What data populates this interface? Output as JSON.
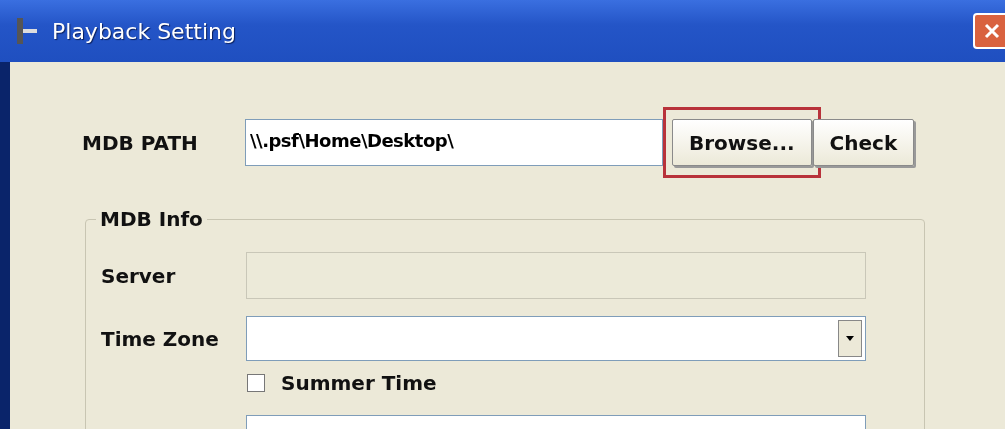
{
  "window": {
    "title": "Playback Setting"
  },
  "mdb_path": {
    "label": "MDB PATH",
    "value": "\\\\.psf\\Home\\Desktop\\"
  },
  "buttons": [
    {
      "label": "Browse...",
      "highlighted": true
    },
    {
      "label": "Check",
      "highlighted": false
    }
  ],
  "mdb_info": {
    "title": "MDB Info",
    "server": {
      "label": "Server",
      "disabled": true
    },
    "time_zone": {
      "label": "Time Zone"
    },
    "summer_time": {
      "label": "Summer Time",
      "checked": false
    }
  }
}
